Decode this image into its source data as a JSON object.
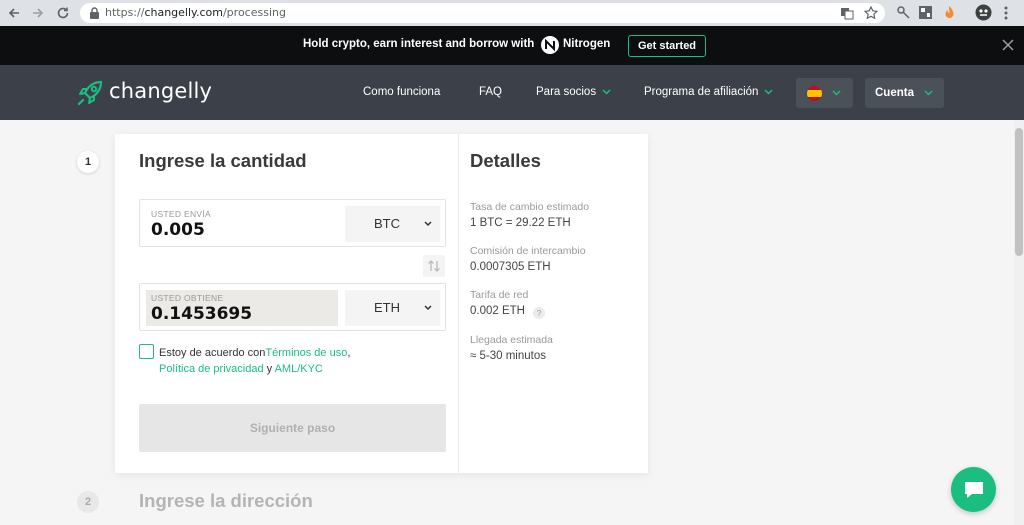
{
  "browser": {
    "url_prefix": "https://",
    "url_host": "changelly.com",
    "url_path": "/processing"
  },
  "promo": {
    "text": "Hold crypto, earn interest and borrow with",
    "brand": "Nitrogen",
    "button": "Get started"
  },
  "header": {
    "logo": "changelly",
    "menu": [
      "Como funciona",
      "FAQ",
      "Para socios",
      "Programa de afiliación"
    ],
    "account": "Cuenta"
  },
  "steps": {
    "step1_number": "1",
    "step1_title": "Ingrese la cantidad",
    "step2_number": "2",
    "step2_title": "Ingrese la dirección"
  },
  "exchange": {
    "send_label": "USTED ENVÍA",
    "send_value": "0.005",
    "send_currency": "BTC",
    "get_label": "USTED OBTIENE",
    "get_value": "0.1453695",
    "get_currency": "ETH"
  },
  "agreement": {
    "prefix": "Estoy de acuerdo con",
    "terms": "Términos de uso",
    "comma": ",",
    "privacy": "Política de privacidad",
    "and": " y ",
    "aml": "AML/KYC"
  },
  "next_button": "Siguiente paso",
  "details": {
    "title": "Detalles",
    "rate_label": "Tasa de cambio estimado",
    "rate_value": "1 BTC = 29.22 ETH",
    "fee_label": "Comisión de intercambio",
    "fee_value": "0.0007305 ETH",
    "network_label": "Tarifa de red",
    "network_value": "0.002 ETH",
    "network_help": "?",
    "arrival_label": "Llegada estimada",
    "arrival_value": "≈ 5-30 minutos"
  },
  "colors": {
    "accent": "#1bbe7f",
    "header_bg": "#3c4149",
    "promo_bg": "#0d0e10"
  }
}
